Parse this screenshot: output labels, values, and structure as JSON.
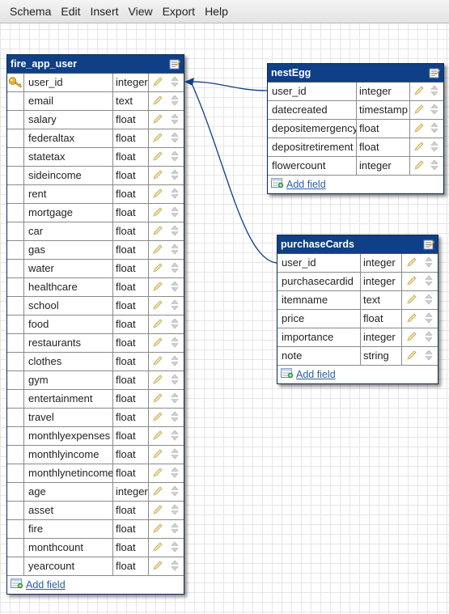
{
  "menu": [
    "Schema",
    "Edit",
    "Insert",
    "View",
    "Export",
    "Help"
  ],
  "tables": {
    "fire_app_user": {
      "name": "fire_app_user",
      "fields": [
        {
          "name": "user_id",
          "type": "integer",
          "key": true
        },
        {
          "name": "email",
          "type": "text"
        },
        {
          "name": "salary",
          "type": "float"
        },
        {
          "name": "federaltax",
          "type": "float"
        },
        {
          "name": "statetax",
          "type": "float"
        },
        {
          "name": "sideincome",
          "type": "float"
        },
        {
          "name": "rent",
          "type": "float"
        },
        {
          "name": "mortgage",
          "type": "float"
        },
        {
          "name": "car",
          "type": "float"
        },
        {
          "name": "gas",
          "type": "float"
        },
        {
          "name": "water",
          "type": "float"
        },
        {
          "name": "healthcare",
          "type": "float"
        },
        {
          "name": "school",
          "type": "float"
        },
        {
          "name": "food",
          "type": "float"
        },
        {
          "name": "restaurants",
          "type": "float"
        },
        {
          "name": "clothes",
          "type": "float"
        },
        {
          "name": "gym",
          "type": "float"
        },
        {
          "name": "entertainment",
          "type": "float"
        },
        {
          "name": "travel",
          "type": "float"
        },
        {
          "name": "monthlyexpenses",
          "type": "float"
        },
        {
          "name": "monthlyincome",
          "type": "float"
        },
        {
          "name": "monthlynetincome",
          "type": "float"
        },
        {
          "name": "age",
          "type": "integer"
        },
        {
          "name": "asset",
          "type": "float"
        },
        {
          "name": "fire",
          "type": "float"
        },
        {
          "name": "monthcount",
          "type": "float"
        },
        {
          "name": "yearcount",
          "type": "float"
        }
      ],
      "add_field_label": "Add field"
    },
    "nestEgg": {
      "name": "nestEgg",
      "fields": [
        {
          "name": "user_id",
          "type": "integer"
        },
        {
          "name": "datecreated",
          "type": "timestamp"
        },
        {
          "name": "depositemergency",
          "type": "float"
        },
        {
          "name": "depositretirement",
          "type": "float"
        },
        {
          "name": "flowercount",
          "type": "integer"
        }
      ],
      "add_field_label": "Add field"
    },
    "purchaseCards": {
      "name": "purchaseCards",
      "fields": [
        {
          "name": "user_id",
          "type": "integer"
        },
        {
          "name": "purchasecardid",
          "type": "integer"
        },
        {
          "name": "itemname",
          "type": "text"
        },
        {
          "name": "price",
          "type": "float"
        },
        {
          "name": "importance",
          "type": "integer"
        },
        {
          "name": "note",
          "type": "string"
        }
      ],
      "add_field_label": "Add field"
    }
  },
  "colors": {
    "header": "#0f3f86",
    "link_line": "#0f3f86",
    "add_link": "#2a5db0"
  },
  "icons": {
    "edit_table": "edit-table-icon",
    "key": "key-icon",
    "pencil": "pencil-icon",
    "updown": "move-up-down-icon",
    "add_field": "add-field-icon"
  }
}
